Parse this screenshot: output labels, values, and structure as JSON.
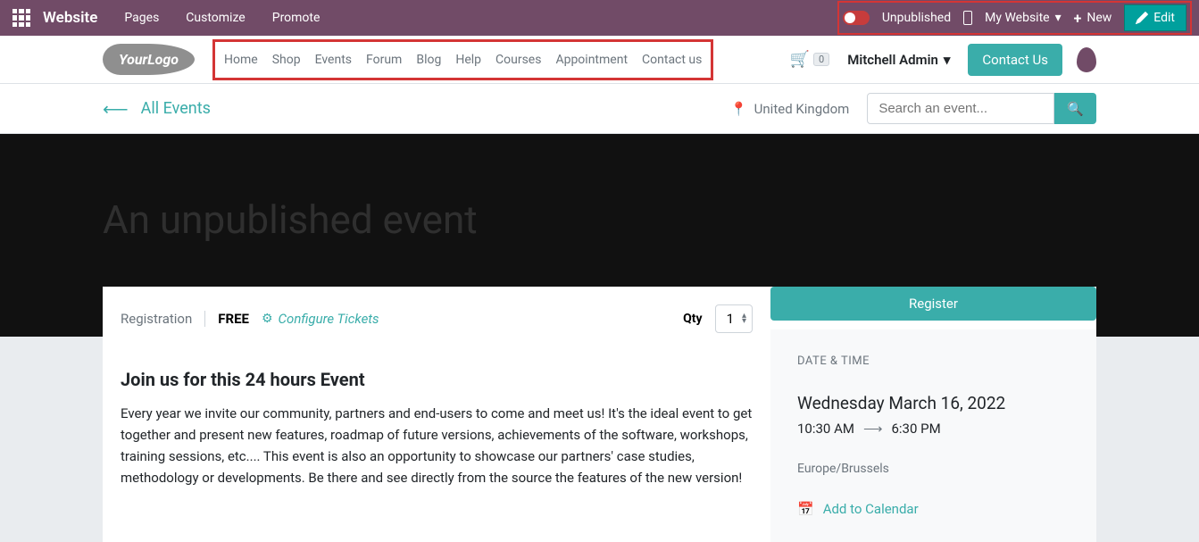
{
  "admin": {
    "title": "Website",
    "links": [
      "Pages",
      "Customize",
      "Promote"
    ],
    "status": "Unpublished",
    "site_switcher": "My Website",
    "new_label": "New",
    "edit_label": "Edit"
  },
  "header": {
    "logo_text": "YourLogo",
    "nav": [
      "Home",
      "Shop",
      "Events",
      "Forum",
      "Blog",
      "Help",
      "Courses",
      "Appointment",
      "Contact us"
    ],
    "cart_count": "0",
    "user": "Mitchell Admin",
    "contact_label": "Contact Us"
  },
  "crumb": {
    "back_label": "All Events",
    "location": "United Kingdom",
    "search_placeholder": "Search an event..."
  },
  "hero": {
    "title": "An unpublished event"
  },
  "registration": {
    "label": "Registration",
    "price": "FREE",
    "configure": "Configure Tickets",
    "qty_label": "Qty",
    "qty_value": "1",
    "register_label": "Register"
  },
  "description": {
    "title": "Join us for this 24 hours Event",
    "body": "Every year we invite our community, partners and end-users to come and meet us! It's the ideal event to get together and present new features, roadmap of future versions, achievements of the software, workshops, training sessions, etc.... This event is also an opportunity to showcase our partners' case studies, methodology or developments. Be there and see directly from the source the features of the new version!"
  },
  "sidebar": {
    "heading": "DATE & TIME",
    "date": "Wednesday March 16, 2022",
    "start": "10:30 AM",
    "end": "6:30 PM",
    "tz": "Europe/Brussels",
    "calendar": "Add to Calendar"
  }
}
